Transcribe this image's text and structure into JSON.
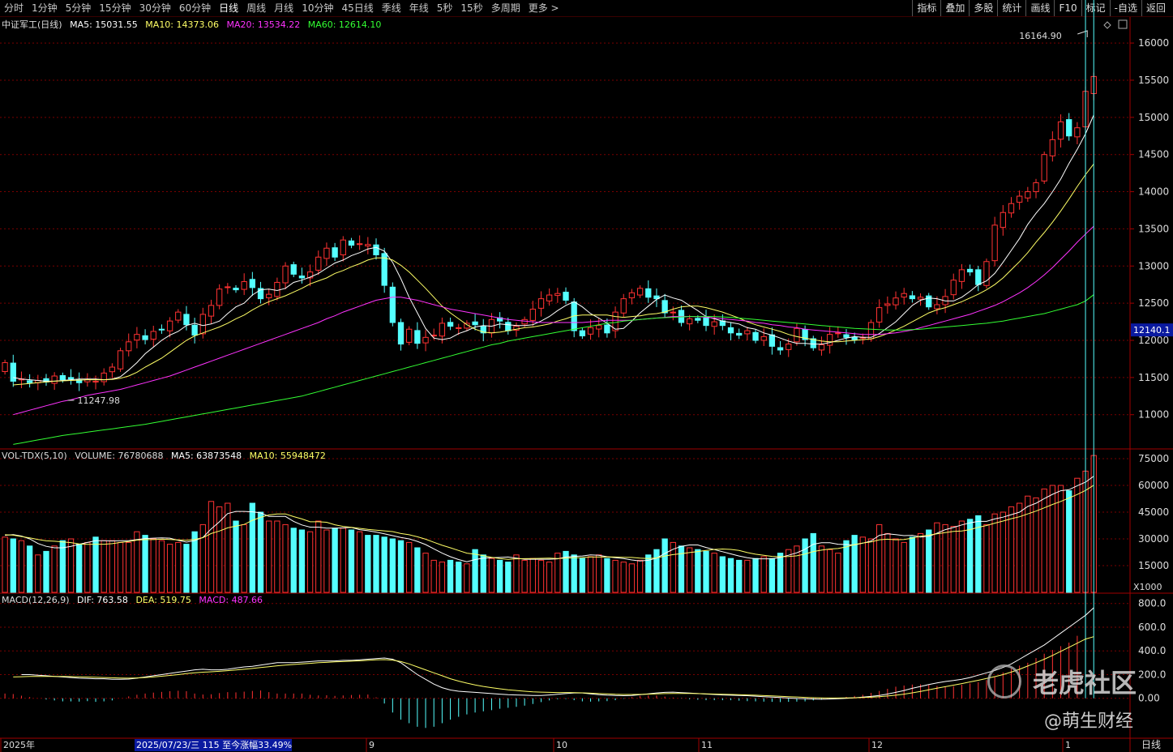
{
  "topbar": {
    "tabs": [
      "分时",
      "1分钟",
      "5分钟",
      "15分钟",
      "30分钟",
      "60分钟",
      "日线",
      "周线",
      "月线",
      "10分钟",
      "45日线",
      "季线",
      "年线",
      "5秒",
      "15秒",
      "多周期",
      "更多 >"
    ],
    "active_tab": "日线",
    "right_buttons": [
      "指标",
      "叠加",
      "多股",
      "统计",
      "画线",
      "F10",
      "标记",
      "-自选",
      "返回"
    ]
  },
  "price_panel": {
    "legend": {
      "name": "中证军工(日线)",
      "ma5": "MA5: 15031.55",
      "ma10": "MA10: 14373.06",
      "ma20": "MA20: 13534.22",
      "ma60": "MA60: 12614.10"
    },
    "high_marker": "16164.90",
    "low_marker": "11247.98",
    "current_price_tag": "12140.1",
    "y_ticks": [
      "16000",
      "15500",
      "15000",
      "14500",
      "14000",
      "13500",
      "13000",
      "12500",
      "12000",
      "11500",
      "11000"
    ]
  },
  "volume_panel": {
    "legend": {
      "name": "VOL-TDX(5,10)",
      "volume": "VOLUME: 76780688",
      "ma5": "MA5: 63873548",
      "ma10": "MA10: 55948472"
    },
    "y_ticks": [
      "75000",
      "60000",
      "45000",
      "30000",
      "15000"
    ],
    "unit": "X1000"
  },
  "macd_panel": {
    "legend": {
      "name": "MACD(12,26,9)",
      "dif": "DIF: 763.58",
      "dea": "DEA: 519.75",
      "macd": "MACD: 487.66"
    },
    "y_ticks": [
      "800.0",
      "600.0",
      "400.0",
      "200.0",
      "0.00"
    ]
  },
  "x_axis": {
    "labels": [
      "2025年",
      "9",
      "10",
      "11",
      "12",
      "1"
    ],
    "selection": "2025/07/23/三 115 至今涨幅33.49%",
    "period": "日线"
  },
  "watermark": {
    "brand": "老虎社区",
    "author": "@萌生财经"
  },
  "colors": {
    "up": "#ff3232",
    "down": "#54ffff",
    "ma5": "#ffffff",
    "ma10": "#ffff66",
    "ma20": "#ff33ff",
    "ma60": "#33ff33",
    "grid": "#7a0000"
  },
  "chart_data": {
    "type": "candlestick",
    "start_date": "2025/07/23",
    "close": [
      11700,
      11450,
      11480,
      11430,
      11460,
      11440,
      11520,
      11470,
      11480,
      11430,
      11470,
      11450,
      11560,
      11640,
      11860,
      11980,
      12080,
      12010,
      12120,
      12140,
      12260,
      12380,
      12210,
      12070,
      12350,
      12470,
      12690,
      12720,
      12680,
      12790,
      12710,
      12560,
      12620,
      12780,
      13000,
      12890,
      12840,
      12920,
      13120,
      13240,
      13120,
      13350,
      13280,
      13300,
      13290,
      13150,
      12740,
      12240,
      11950,
      12150,
      11960,
      12040,
      12070,
      12230,
      12190,
      12170,
      12230,
      12210,
      12100,
      12280,
      12260,
      12130,
      12190,
      12280,
      12420,
      12560,
      12610,
      12630,
      12540,
      12130,
      12060,
      12170,
      12200,
      12100,
      12380,
      12560,
      12640,
      12700,
      12580,
      12560,
      12370,
      12380,
      12240,
      12290,
      12270,
      12200,
      12250,
      12200,
      12100,
      12070,
      12130,
      12000,
      12050,
      11920,
      11870,
      11950,
      12160,
      12010,
      11900,
      11940,
      12080,
      12100,
      12040,
      12010,
      12040,
      12240,
      12440,
      12490,
      12570,
      12630,
      12560,
      12580,
      12450,
      12480,
      12590,
      12810,
      12950,
      12920,
      12750,
      13060,
      13550,
      13720,
      13840,
      13940,
      14000,
      14120,
      14500,
      14700,
      14940,
      14750,
      14860,
      15350,
      15550
    ],
    "volume_x1000": [
      37000,
      33000,
      30000,
      31000,
      28000,
      33000,
      34000,
      34000,
      31000,
      30000,
      29000,
      26000,
      21000,
      23000,
      26000,
      29000,
      30000,
      27000,
      28000,
      31000,
      29000,
      29000,
      28000,
      28000,
      34000,
      32000,
      30000,
      29000,
      27000,
      28000,
      27000,
      34000,
      38000,
      51000,
      48000,
      50000,
      40000,
      38000,
      50000,
      45000,
      40000,
      40000,
      38000,
      36000,
      35000,
      34000,
      40000,
      35000,
      36000,
      36000,
      35000,
      34000,
      32000,
      32000,
      31000,
      30000,
      29000,
      28000,
      25000,
      22000,
      18000,
      17000,
      18000,
      17000,
      16000,
      24000,
      21000,
      19000,
      18000,
      17000,
      21000,
      18000,
      19000,
      18000,
      17000,
      22000,
      23000,
      21000,
      19000,
      20000,
      21000,
      19000,
      18000,
      17000,
      16000,
      18000,
      21000,
      24000,
      30000,
      28000,
      26000,
      25000,
      24000,
      23000,
      22000,
      20000,
      19000,
      18000,
      18000,
      19000,
      20000,
      19000,
      22000,
      24000,
      26000,
      30000,
      33000,
      26000,
      24000,
      22000,
      29000,
      32000,
      31000,
      30000,
      38000,
      33000,
      30000,
      28000,
      31000,
      33000,
      35000,
      39000,
      38000,
      37000,
      40000,
      41000,
      43000,
      38000,
      44000,
      45000,
      48000,
      50000,
      54000,
      53000,
      58000,
      60000,
      60000,
      57000,
      64000,
      68000,
      76780
    ],
    "ma5": [
      11500,
      11480,
      11470,
      11460,
      11450,
      11450,
      11460,
      11470,
      11480,
      11480,
      11480,
      11470,
      11480,
      11510,
      11600,
      11700,
      11820,
      11910,
      12000,
      12070,
      12120,
      12200,
      12230,
      12200,
      12220,
      12260,
      12360,
      12450,
      12500,
      12610,
      12680,
      12690,
      12670,
      12700,
      12780,
      12810,
      12850,
      12900,
      12970,
      13040,
      13080,
      13140,
      13180,
      13230,
      13250,
      13200,
      13050,
      12830,
      12580,
      12370,
      12160,
      12030,
      12010,
      12030,
      12090,
      12130,
      12180,
      12200,
      12190,
      12220,
      12210,
      12200,
      12200,
      12210,
      12260,
      12320,
      12400,
      12470,
      12520,
      12450,
      12360,
      12300,
      12230,
      12150,
      12160,
      12260,
      12370,
      12460,
      12550,
      12610,
      12570,
      12540,
      12470,
      12400,
      12320,
      12290,
      12260,
      12240,
      12220,
      12170,
      12150,
      12100,
      12070,
      12030,
      11990,
      11960,
      11960,
      11950,
      11950,
      11970,
      12000,
      12030,
      12050,
      12040,
      12040,
      12090,
      12170,
      12250,
      12360,
      12470,
      12540,
      12570,
      12560,
      12530,
      12530,
      12580,
      12660,
      12750,
      12800,
      12900,
      13050,
      13210,
      13370,
      13560,
      13710,
      13840,
      14000,
      14170,
      14380,
      14570,
      14780,
      15031
    ],
    "ma10": [
      11400,
      11410,
      11420,
      11430,
      11440,
      11450,
      11455,
      11460,
      11465,
      11470,
      11470,
      11470,
      11475,
      11490,
      11520,
      11570,
      11640,
      11700,
      11760,
      11840,
      11920,
      12000,
      12060,
      12100,
      12140,
      12180,
      12230,
      12290,
      12340,
      12410,
      12470,
      12520,
      12560,
      12600,
      12650,
      12700,
      12760,
      12800,
      12840,
      12900,
      12940,
      12990,
      13030,
      13080,
      13110,
      13110,
      13080,
      13010,
      12920,
      12810,
      12700,
      12580,
      12460,
      12370,
      12290,
      12210,
      12150,
      12110,
      12100,
      12110,
      12130,
      12150,
      12170,
      12180,
      12200,
      12220,
      12260,
      12290,
      12330,
      12340,
      12340,
      12340,
      12340,
      12320,
      12310,
      12320,
      12330,
      12350,
      12360,
      12380,
      12420,
      12450,
      12460,
      12460,
      12440,
      12410,
      12380,
      12340,
      12300,
      12250,
      12210,
      12180,
      12150,
      12120,
      12080,
      12050,
      12030,
      12010,
      11990,
      11980,
      11980,
      11990,
      12000,
      12010,
      12020,
      12050,
      12090,
      12140,
      12190,
      12250,
      12310,
      12370,
      12410,
      12440,
      12480,
      12520,
      12570,
      12620,
      12680,
      12750,
      12840,
      12950,
      13060,
      13180,
      13320,
      13450,
      13590,
      13740,
      13900,
      14070,
      14230,
      14373
    ],
    "ma20": [
      11000,
      11030,
      11060,
      11090,
      11120,
      11150,
      11180,
      11200,
      11230,
      11260,
      11280,
      11300,
      11320,
      11340,
      11370,
      11400,
      11430,
      11460,
      11490,
      11520,
      11560,
      11600,
      11640,
      11680,
      11720,
      11760,
      11800,
      11840,
      11880,
      11920,
      11960,
      12000,
      12040,
      12080,
      12120,
      12160,
      12200,
      12240,
      12290,
      12330,
      12380,
      12420,
      12460,
      12500,
      12540,
      12560,
      12580,
      12580,
      12560,
      12540,
      12510,
      12480,
      12450,
      12420,
      12400,
      12380,
      12360,
      12340,
      12320,
      12300,
      12280,
      12270,
      12260,
      12250,
      12240,
      12240,
      12240,
      12240,
      12240,
      12240,
      12250,
      12260,
      12270,
      12270,
      12270,
      12270,
      12280,
      12290,
      12300,
      12310,
      12320,
      12320,
      12320,
      12320,
      12310,
      12300,
      12290,
      12280,
      12270,
      12260,
      12240,
      12230,
      12210,
      12200,
      12180,
      12170,
      12150,
      12140,
      12130,
      12120,
      12110,
      12100,
      12090,
      12080,
      12080,
      12080,
      12090,
      12100,
      12120,
      12140,
      12170,
      12200,
      12230,
      12260,
      12290,
      12320,
      12350,
      12390,
      12430,
      12470,
      12520,
      12580,
      12640,
      12710,
      12790,
      12880,
      12980,
      13090,
      13200,
      13320,
      13430,
      13534
    ],
    "ma60": [
      10600,
      10620,
      10640,
      10660,
      10680,
      10700,
      10720,
      10735,
      10750,
      10765,
      10780,
      10795,
      10810,
      10825,
      10840,
      10855,
      10870,
      10890,
      10910,
      10930,
      10950,
      10970,
      10990,
      11010,
      11030,
      11050,
      11070,
      11090,
      11110,
      11130,
      11150,
      11170,
      11190,
      11210,
      11230,
      11250,
      11280,
      11310,
      11340,
      11370,
      11400,
      11430,
      11460,
      11490,
      11520,
      11550,
      11580,
      11610,
      11640,
      11670,
      11700,
      11730,
      11760,
      11790,
      11820,
      11850,
      11880,
      11910,
      11940,
      11960,
      11990,
      12010,
      12030,
      12050,
      12070,
      12090,
      12110,
      12130,
      12150,
      12170,
      12190,
      12210,
      12230,
      12240,
      12260,
      12270,
      12280,
      12290,
      12300,
      12305,
      12310,
      12315,
      12320,
      12320,
      12320,
      12320,
      12315,
      12310,
      12300,
      12290,
      12280,
      12270,
      12260,
      12250,
      12240,
      12230,
      12220,
      12210,
      12200,
      12190,
      12180,
      12170,
      12160,
      12155,
      12150,
      12145,
      12140,
      12140,
      12140,
      12145,
      12150,
      12160,
      12170,
      12180,
      12190,
      12200,
      12210,
      12220,
      12230,
      12245,
      12260,
      12280,
      12300,
      12320,
      12340,
      12360,
      12390,
      12420,
      12450,
      12480,
      12530,
      12614
    ],
    "macd_dif": [
      200,
      200,
      195,
      190,
      185,
      180,
      175,
      170,
      168,
      165,
      165,
      160,
      160,
      162,
      170,
      180,
      190,
      200,
      210,
      220,
      230,
      240,
      245,
      240,
      240,
      245,
      255,
      265,
      270,
      280,
      290,
      300,
      300,
      300,
      305,
      310,
      315,
      315,
      315,
      320,
      320,
      325,
      330,
      335,
      340,
      330,
      300,
      250,
      200,
      160,
      120,
      90,
      70,
      60,
      55,
      50,
      45,
      40,
      35,
      30,
      28,
      26,
      24,
      24,
      28,
      34,
      40,
      45,
      45,
      38,
      30,
      26,
      24,
      22,
      24,
      30,
      38,
      45,
      50,
      52,
      48,
      44,
      40,
      36,
      32,
      28,
      26,
      24,
      22,
      18,
      14,
      10,
      6,
      2,
      -2,
      -4,
      -6,
      -8,
      -6,
      -4,
      0,
      4,
      10,
      16,
      24,
      36,
      50,
      66,
      84,
      100,
      116,
      130,
      142,
      150,
      160,
      175,
      195,
      215,
      235,
      260,
      290,
      330,
      370,
      410,
      450,
      500,
      550,
      600,
      650,
      700,
      763.58
    ],
    "macd_dea": [
      180,
      182,
      184,
      185,
      185,
      185,
      184,
      183,
      181,
      179,
      177,
      175,
      173,
      171,
      170,
      172,
      175,
      180,
      186,
      193,
      200,
      208,
      215,
      220,
      224,
      228,
      233,
      239,
      245,
      252,
      259,
      267,
      274,
      280,
      285,
      290,
      295,
      300,
      303,
      307,
      310,
      313,
      316,
      320,
      324,
      326,
      322,
      310,
      290,
      265,
      240,
      215,
      190,
      165,
      145,
      128,
      113,
      100,
      90,
      80,
      72,
      66,
      60,
      55,
      52,
      50,
      49,
      49,
      48,
      46,
      43,
      40,
      37,
      34,
      32,
      32,
      33,
      35,
      38,
      40,
      41,
      41,
      41,
      40,
      38,
      36,
      34,
      32,
      30,
      28,
      26,
      23,
      20,
      17,
      14,
      11,
      8,
      5,
      3,
      2,
      2,
      3,
      4,
      6,
      9,
      13,
      19,
      26,
      35,
      46,
      58,
      71,
      85,
      98,
      111,
      124,
      138,
      152,
      167,
      183,
      200,
      221,
      245,
      272,
      300,
      330,
      362,
      396,
      430,
      465,
      500,
      519.75
    ]
  }
}
